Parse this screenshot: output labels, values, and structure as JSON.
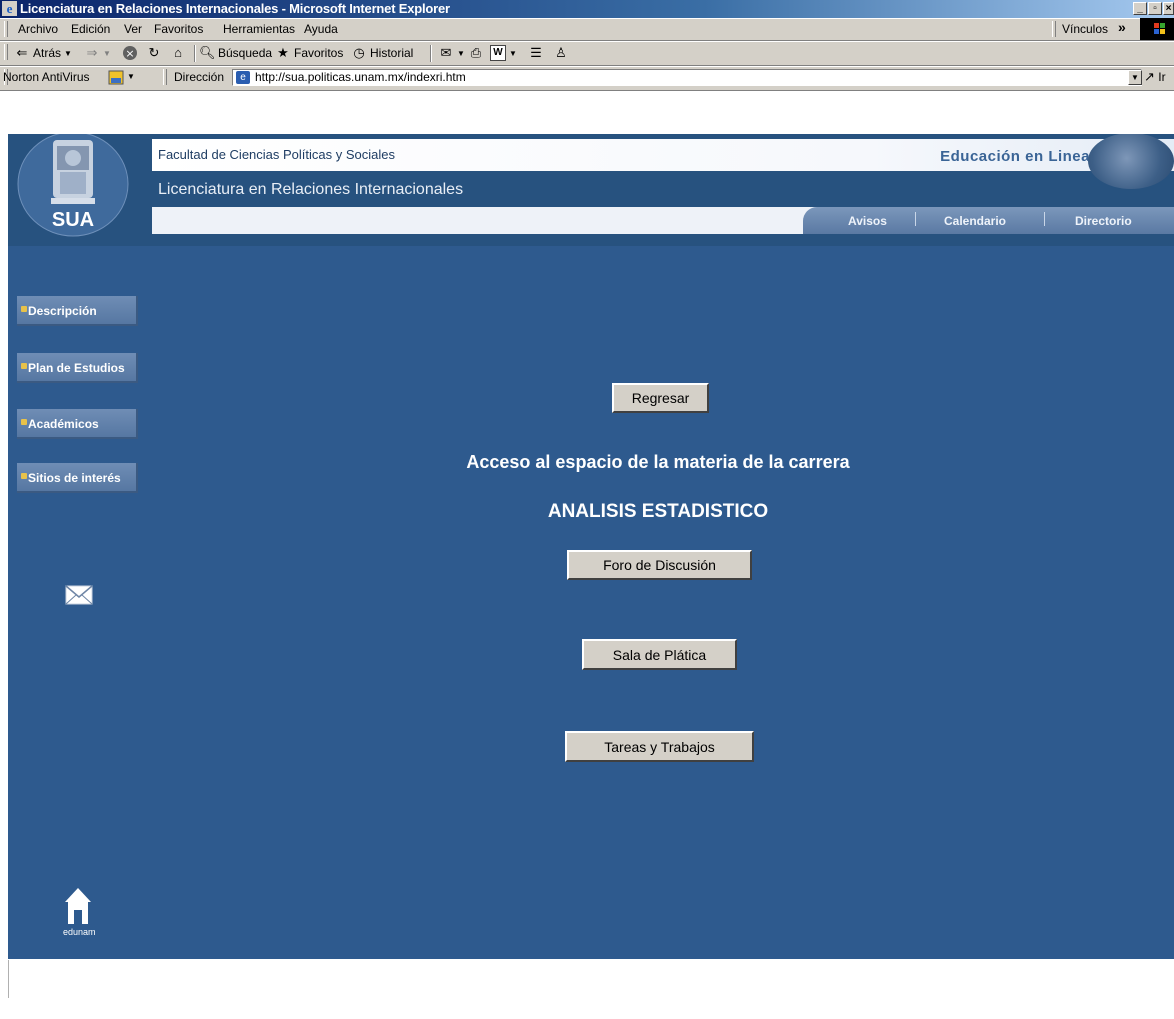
{
  "window": {
    "title": "Licenciatura en Relaciones Internacionales - Microsoft Internet Explorer"
  },
  "menubar": {
    "items": [
      "Archivo",
      "Edición",
      "Ver",
      "Favoritos",
      "Herramientas",
      "Ayuda"
    ],
    "links_label": "Vínculos",
    "more_glyph": "»"
  },
  "toolbar": {
    "back_label": "Atrás",
    "search_label": "Búsqueda",
    "favorites_label": "Favoritos",
    "history_label": "Historial"
  },
  "addressbar": {
    "norton_label": "Norton AntiVirus",
    "address_label": "Dirección",
    "url": "http://sua.politicas.unam.mx/indexri.htm",
    "go_label": "Ir"
  },
  "header": {
    "faculty": "Facultad de Ciencias Políticas y Sociales",
    "program": "Licenciatura en Relaciones Internacionales",
    "edu_online": "Educación en Linea",
    "logo_text": "SUA",
    "nav": [
      "Avisos",
      "Calendario",
      "Directorio"
    ]
  },
  "sidebar": {
    "items": [
      "Descripción",
      "Plan de Estudios",
      "Académicos",
      "Sitios de interés"
    ],
    "home_label": "edunam"
  },
  "main": {
    "back_button": "Regresar",
    "heading": "Acceso al espacio de la materia de la carrera",
    "subject": "ANALISIS ESTADISTICO",
    "buttons": [
      "Foro de Discusión",
      "Sala de Plática",
      "Tareas y Trabajos"
    ]
  },
  "colors": {
    "page_background": "#2e5a8e",
    "title_bar": "#0a246a",
    "chrome": "#d4d0c8"
  }
}
